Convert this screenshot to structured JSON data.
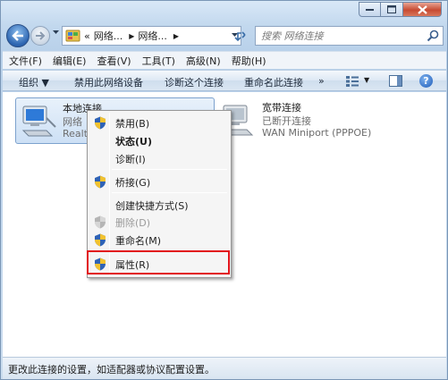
{
  "window": {
    "caption_buttons": [
      "minimize",
      "maximize",
      "close"
    ]
  },
  "address_bar": {
    "prefix": "«",
    "crumbs": [
      "网络...",
      "网络..."
    ],
    "search_placeholder": "搜索 网络连接"
  },
  "menubar": {
    "items": [
      "文件(F)",
      "编辑(E)",
      "查看(V)",
      "工具(T)",
      "高级(N)",
      "帮助(H)"
    ]
  },
  "commandbar": {
    "organize": "组织 ▼",
    "disable": "禁用此网络设备",
    "diagnose": "诊断这个连接",
    "rename": "重命名此连接",
    "more": "»"
  },
  "connections": {
    "local": {
      "name": "本地连接",
      "network": "网络",
      "adapter": "Realte"
    },
    "broadband": {
      "name": "宽带连接",
      "status": "已断开连接",
      "device": "WAN Miniport (PPPOE)"
    }
  },
  "context_menu": {
    "items": [
      {
        "label": "禁用(B)",
        "shield": true
      },
      {
        "label": "状态(U)",
        "bold": true
      },
      {
        "label": "诊断(I)"
      },
      {
        "label": "桥接(G)",
        "shield": true
      },
      {
        "label": "创建快捷方式(S)"
      },
      {
        "label": "删除(D)",
        "shield": true,
        "disabled": true
      },
      {
        "label": "重命名(M)",
        "shield": true
      },
      {
        "label": "属性(R)",
        "shield": true
      }
    ],
    "highlighted": "属性(R)",
    "highlight_color": "#e2141b"
  },
  "statusbar": {
    "text": "更改此连接的设置，如适配器或协议配置设置。"
  }
}
